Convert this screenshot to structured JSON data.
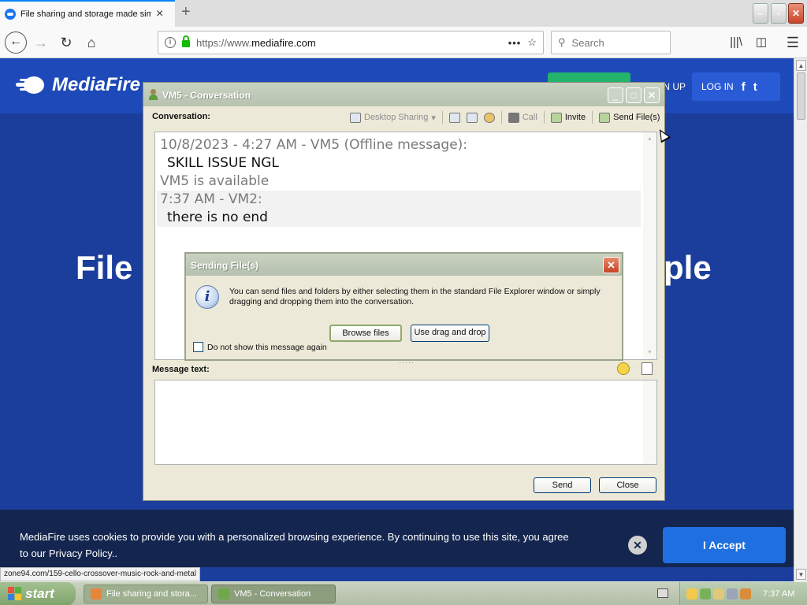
{
  "browser": {
    "tab_title": "File sharing and storage made simple",
    "new_tab_symbol": "+",
    "url_prefix": "https://www.",
    "url_domain": "mediafire.com",
    "search_placeholder": "Search",
    "status_link": "zone94.com/159-cello-crossover-music-rock-and-metal"
  },
  "page": {
    "logo_text": "MediaFire",
    "signup_label": "N UP",
    "login_label": "LOG IN",
    "facebook_symbol": "f",
    "twitter_symbol": "t",
    "hero_left": "File",
    "hero_right": "ple",
    "cookie_text": "MediaFire uses cookies to provide you with a personalized browsing experience. By continuing to use this site, you agree to our Privacy Policy..",
    "cookie_close_symbol": "✕",
    "accept_label": "I Accept",
    "accent_color": "#1f6fe0"
  },
  "conversation": {
    "window_title": "VM5 - Conversation",
    "conversation_label": "Conversation:",
    "toolbar": {
      "desktop_sharing": "Desktop Sharing",
      "call": "Call",
      "invite": "Invite",
      "send_files": "Send File(s)"
    },
    "history": [
      {
        "kind": "meta",
        "text": "10/8/2023 - 4:27 AM - VM5 (Offline message):"
      },
      {
        "kind": "msg",
        "text": "SKILL ISSUE NGL"
      },
      {
        "kind": "meta",
        "text": "VM5 is available"
      },
      {
        "kind": "meta",
        "text": "7:37 AM - VM2:"
      },
      {
        "kind": "msg",
        "text": "there is no end"
      }
    ],
    "message_label": "Message text:",
    "send_label": "Send",
    "close_label": "Close"
  },
  "dialog": {
    "title": "Sending File(s)",
    "info_symbol": "i",
    "text": "You can send files and folders by either selecting them in the standard File Explorer window or simply dragging and dropping them into the conversation.",
    "browse_label": "Browse files",
    "drag_label": "Use drag and drop",
    "noshow_label": "Do not show this message again"
  },
  "taskbar": {
    "start_label": "start",
    "tasks": [
      {
        "label": "File sharing and stora..."
      },
      {
        "label": "VM5 - Conversation"
      }
    ],
    "clock": "7:37 AM"
  }
}
